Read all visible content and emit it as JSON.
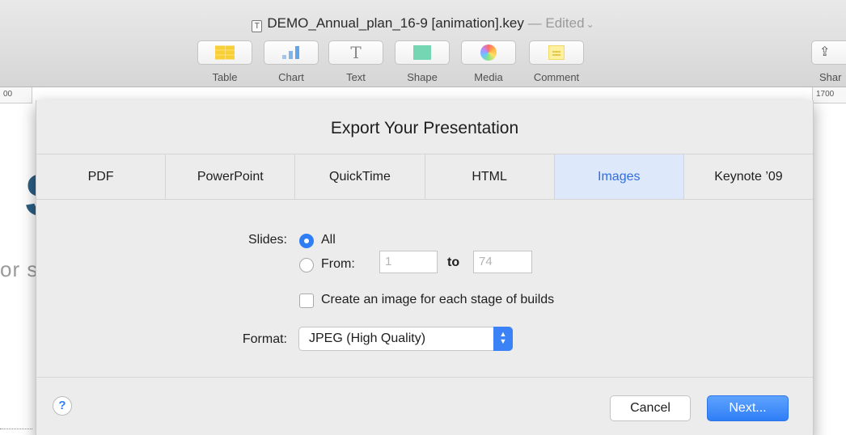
{
  "window": {
    "doc_icon": "keynote-doc-icon",
    "title": "DEMO_Annual_plan_16-9 [animation].key",
    "separator": "—",
    "status": "Edited",
    "status_chevron": "⌄"
  },
  "toolbar": {
    "items": [
      {
        "label": "Table",
        "icon": "table-icon"
      },
      {
        "label": "Chart",
        "icon": "chart-icon"
      },
      {
        "label": "Text",
        "icon": "text-icon",
        "glyph": "T"
      },
      {
        "label": "Shape",
        "icon": "shape-icon"
      },
      {
        "label": "Media",
        "icon": "media-icon"
      },
      {
        "label": "Comment",
        "icon": "comment-icon"
      }
    ],
    "share_label": "Shar",
    "share_icon": "share-icon"
  },
  "rulers": {
    "left": "00",
    "right": "1700"
  },
  "background": {
    "slide_letter": "S",
    "slide_text": "or s"
  },
  "dialog": {
    "title": "Export Your Presentation",
    "tabs": [
      {
        "label": "PDF",
        "active": false
      },
      {
        "label": "PowerPoint",
        "active": false
      },
      {
        "label": "QuickTime",
        "active": false
      },
      {
        "label": "HTML",
        "active": false
      },
      {
        "label": "Images",
        "active": true
      },
      {
        "label": "Keynote ’09",
        "active": false
      }
    ],
    "slides_label": "Slides:",
    "option_all": "All",
    "option_from": "From:",
    "from_value": "1",
    "to_label": "to",
    "to_value": "74",
    "builds_checkbox": "Create an image for each stage of builds",
    "builds_checked": false,
    "format_label": "Format:",
    "format_value": "JPEG (High Quality)",
    "help_glyph": "?",
    "cancel_label": "Cancel",
    "next_label": "Next..."
  },
  "colors": {
    "accent": "#2f7ef6",
    "active_tab_bg": "#dde8fb"
  }
}
